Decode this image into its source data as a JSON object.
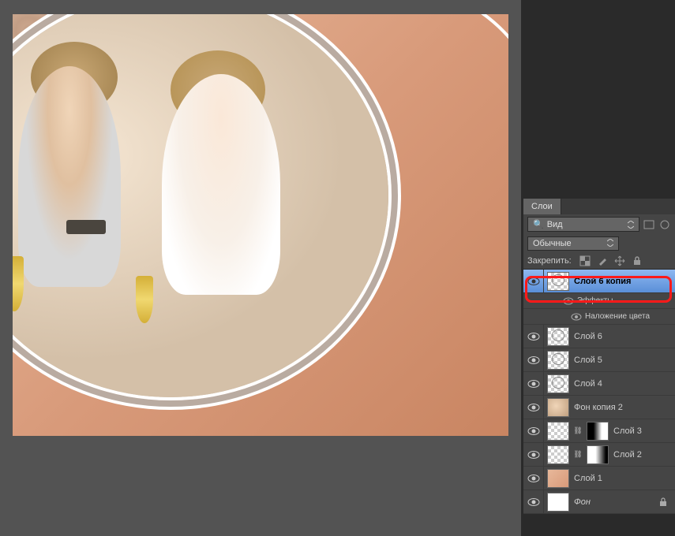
{
  "panel": {
    "tab": "Слои",
    "filter_label": "Вид",
    "blend_mode": "Обычные",
    "lock_label": "Закрепить:"
  },
  "layers": [
    {
      "name": "Слой 6 копия",
      "selected": true,
      "thumb": "checker-oval",
      "vis": true
    },
    {
      "name": "Слой 6",
      "thumb": "checker-oval",
      "vis": true
    },
    {
      "name": "Слой 5",
      "thumb": "checker-oval",
      "vis": true
    },
    {
      "name": "Слой 4",
      "thumb": "checker-oval",
      "vis": true
    },
    {
      "name": "Фон копия 2",
      "thumb": "photo",
      "vis": true
    },
    {
      "name": "Слой 3",
      "thumb": "checker",
      "mask": "gradient-dark",
      "vis": true
    },
    {
      "name": "Слой 2",
      "thumb": "checker",
      "mask": "gradient-light",
      "vis": true
    },
    {
      "name": "Слой 1",
      "thumb": "peach",
      "vis": true
    },
    {
      "name": "Фон",
      "thumb": "white",
      "vis": true,
      "locked": true,
      "italic": true
    }
  ],
  "effects": {
    "heading": "Эффекты",
    "item": "Наложение цвета"
  }
}
